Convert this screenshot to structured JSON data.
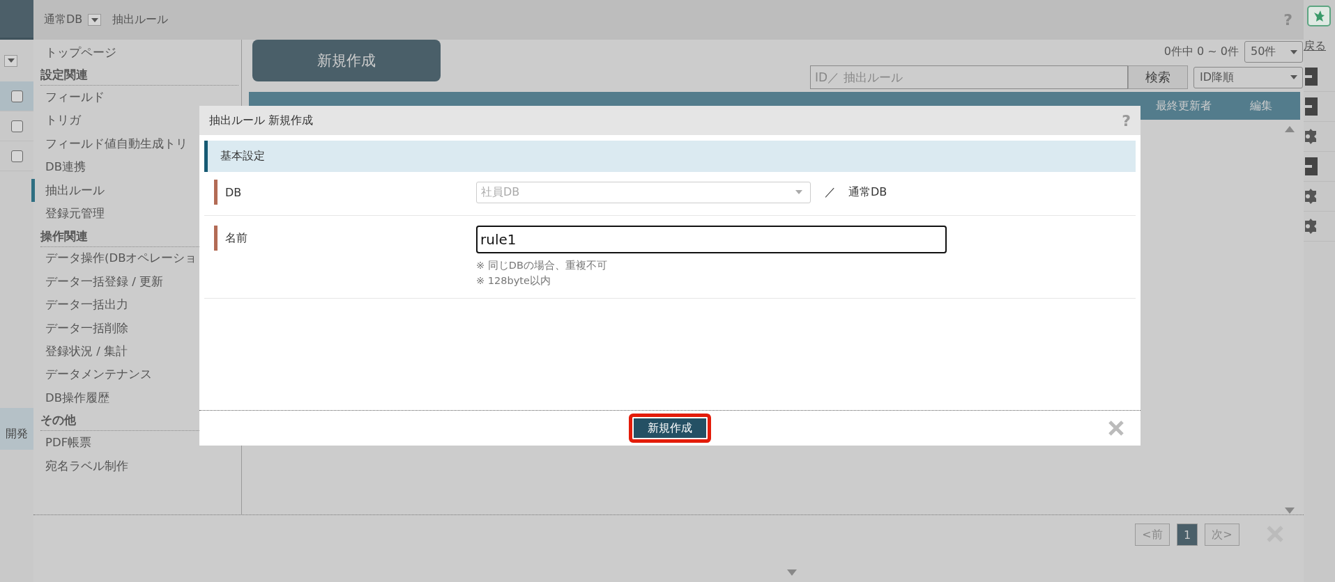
{
  "topbar": {
    "db_label": "通常DB",
    "page_title": "抽出ルール",
    "help": "?"
  },
  "left_rail": {
    "rows": [
      {
        "checked": false,
        "selected": true
      },
      {
        "checked": false,
        "selected": false
      },
      {
        "checked": false,
        "selected": false
      }
    ],
    "dev_label": "開発"
  },
  "sidebar": {
    "items": [
      {
        "kind": "link",
        "label": "トップページ",
        "selected": false
      },
      {
        "kind": "heading",
        "label": "設定関連"
      },
      {
        "kind": "link",
        "label": "フィールド",
        "selected": false
      },
      {
        "kind": "link",
        "label": "トリガ",
        "selected": false
      },
      {
        "kind": "link",
        "label": "フィールド値自動生成トリ",
        "selected": false
      },
      {
        "kind": "link",
        "label": "DB連携",
        "selected": false
      },
      {
        "kind": "link",
        "label": "抽出ルール",
        "selected": true
      },
      {
        "kind": "link",
        "label": "登録元管理",
        "selected": false
      },
      {
        "kind": "heading",
        "label": "操作関連"
      },
      {
        "kind": "link",
        "label": "データ操作(DBオペレーショ",
        "selected": false
      },
      {
        "kind": "link",
        "label": "データ一括登録 / 更新",
        "selected": false
      },
      {
        "kind": "link",
        "label": "データ一括出力",
        "selected": false
      },
      {
        "kind": "link",
        "label": "データ一括削除",
        "selected": false
      },
      {
        "kind": "link",
        "label": "登録状況 / 集計",
        "selected": false
      },
      {
        "kind": "link",
        "label": "データメンテナンス",
        "selected": false
      },
      {
        "kind": "link",
        "label": "DB操作履歴",
        "selected": false
      },
      {
        "kind": "heading",
        "label": "その他"
      },
      {
        "kind": "link",
        "label": "PDF帳票",
        "selected": false
      },
      {
        "kind": "link",
        "label": "宛名ラベル制作",
        "selected": false
      }
    ]
  },
  "main": {
    "new_button": "新規作成",
    "count": "0件中 0 ~ 0件",
    "page_size": "50件",
    "search": {
      "placeholder": "ID／ 抽出ルール"
    },
    "search_button": "検索",
    "sort": "ID降順",
    "table": {
      "columns": [
        "最終更新者",
        "編集"
      ]
    }
  },
  "pagination": {
    "prev": "<前",
    "pages": [
      {
        "label": "1",
        "selected": true
      }
    ],
    "next": "次>"
  },
  "right_rail": {
    "back_link": "戻る",
    "icons": [
      {
        "kind": "box"
      },
      {
        "kind": "box"
      },
      {
        "kind": "gear"
      },
      {
        "kind": "box"
      },
      {
        "kind": "gear"
      },
      {
        "kind": "gear"
      }
    ]
  },
  "dialog": {
    "title": "抽出ルール 新規作成",
    "help": "?",
    "section": "基本設定",
    "fields": [
      {
        "kind": "select",
        "label": "DB",
        "value": "社員DB",
        "disabled": true,
        "suffix": "／",
        "suffix_value": "通常DB"
      },
      {
        "kind": "text",
        "label": "名前",
        "value": "rule1",
        "notes": [
          "※ 同じDBの場合、重複不可",
          "※ 128byte以内"
        ]
      }
    ],
    "submit": "新規作成",
    "submit_highlighted": true
  }
}
